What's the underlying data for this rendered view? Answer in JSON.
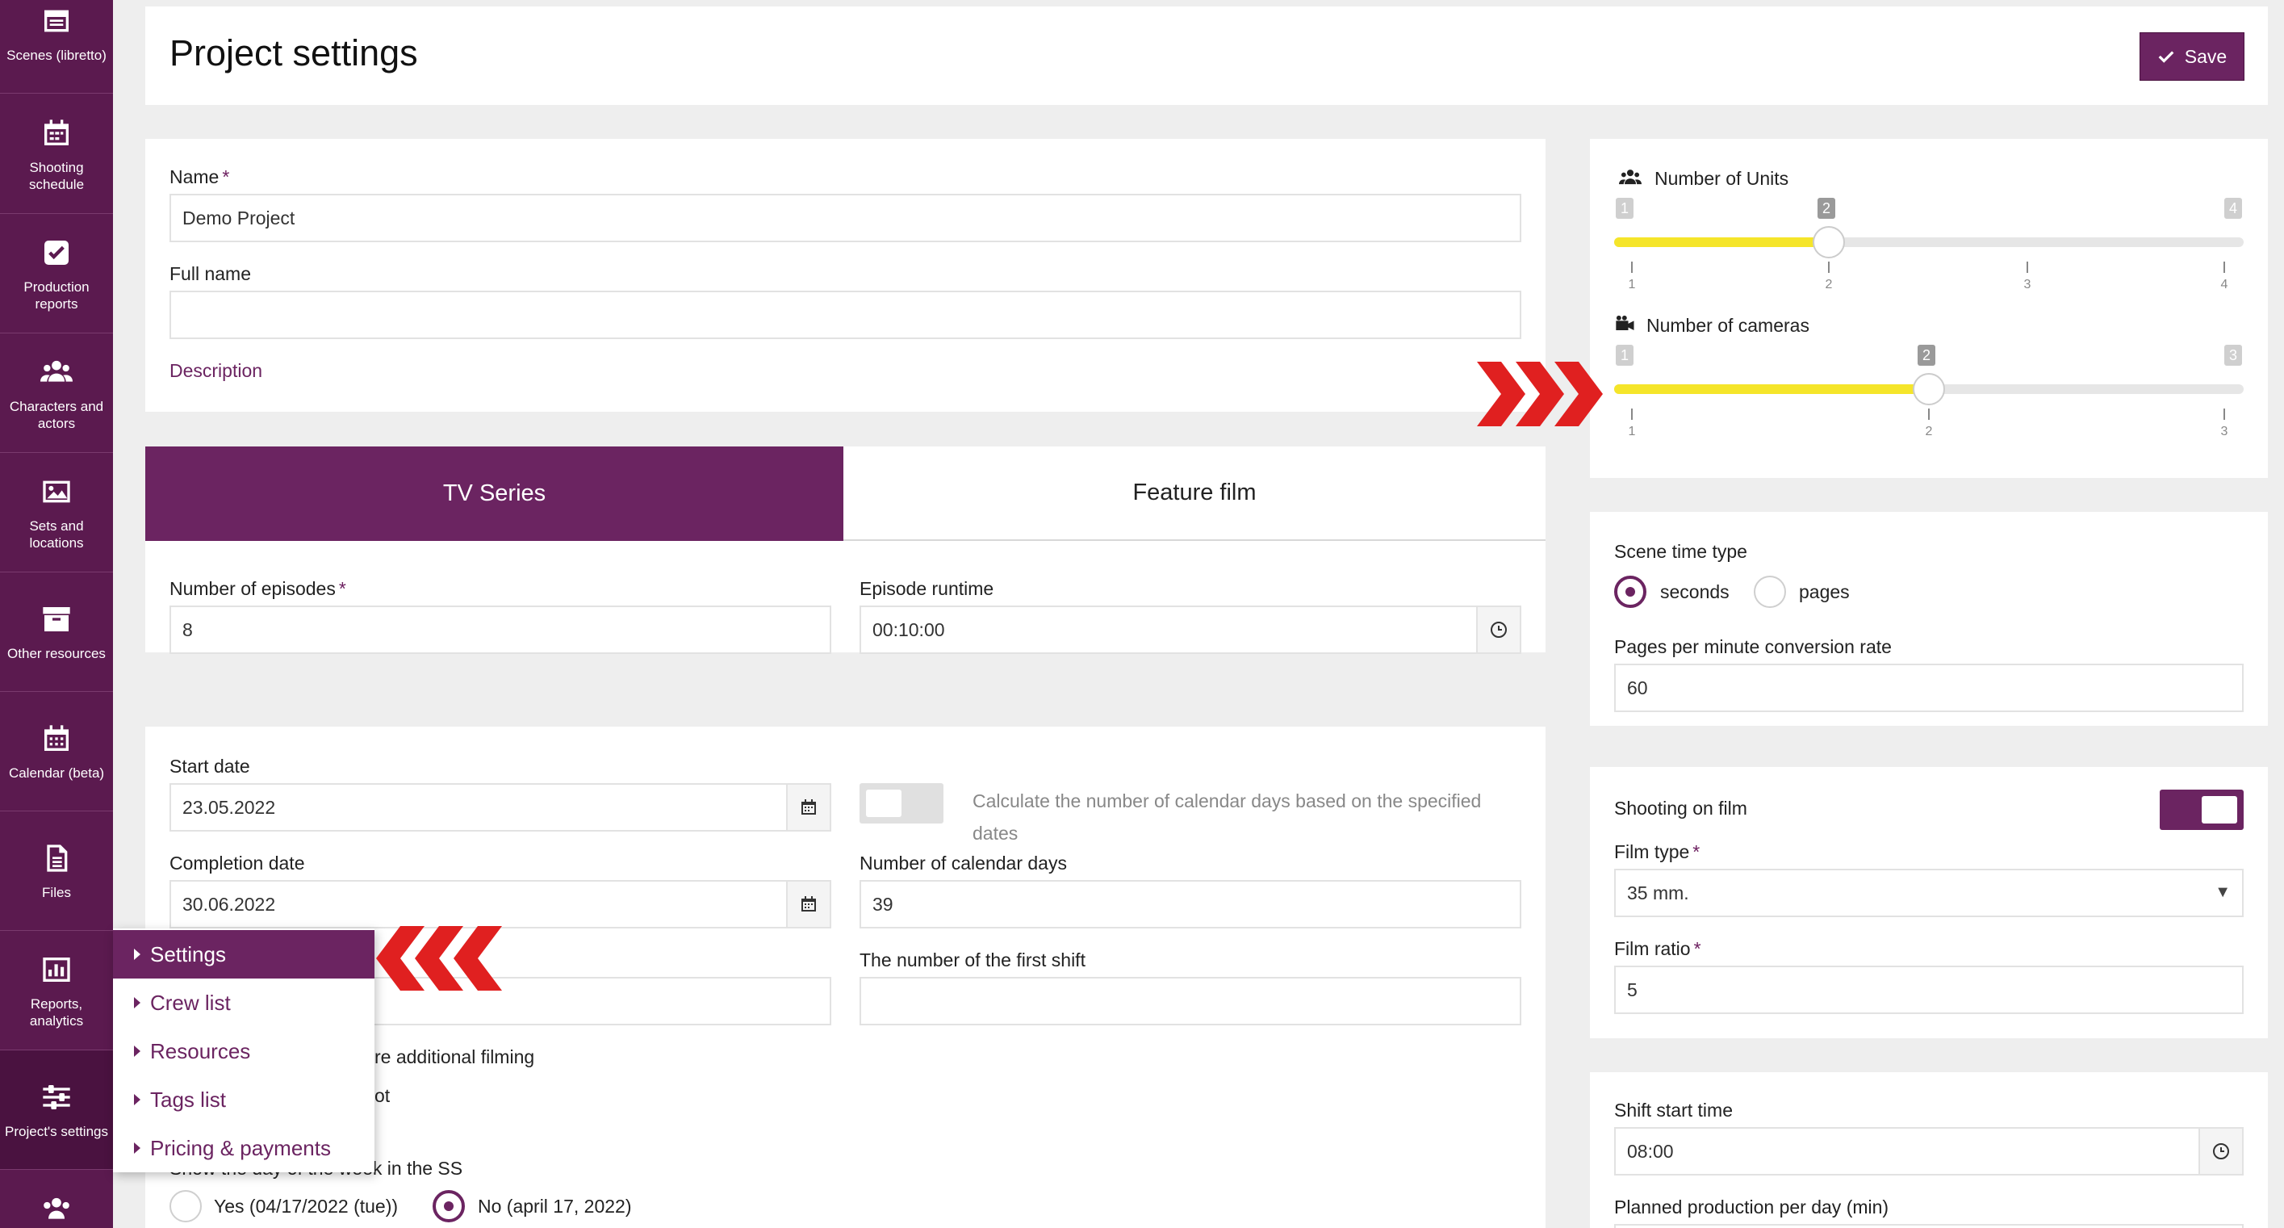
{
  "sidebar": {
    "items": [
      {
        "label": "Scenes (libretto)",
        "icon": "clapperboard-icon"
      },
      {
        "label": "Shooting schedule",
        "icon": "calendar-grid-icon"
      },
      {
        "label": "Production reports",
        "icon": "checkbox-icon"
      },
      {
        "label": "Characters and actors",
        "icon": "users-icon"
      },
      {
        "label": "Sets and locations",
        "icon": "image-icon"
      },
      {
        "label": "Other resources",
        "icon": "archive-icon"
      },
      {
        "label": "Calendar (beta)",
        "icon": "calendar-icon"
      },
      {
        "label": "Files",
        "icon": "file-icon"
      },
      {
        "label": "Reports, analytics",
        "icon": "bar-chart-icon"
      },
      {
        "label": "Project's settings",
        "icon": "sliders-icon"
      }
    ]
  },
  "header": {
    "title": "Project settings",
    "save_label": "Save"
  },
  "general": {
    "name_label": "Name",
    "name_value": "Demo Project",
    "fullname_label": "Full name",
    "fullname_value": "",
    "description_link": "Description"
  },
  "tabs": [
    {
      "label": "TV Series"
    },
    {
      "label": "Feature film"
    }
  ],
  "series": {
    "episodes_label": "Number of episodes",
    "episodes_value": "8",
    "runtime_label": "Episode runtime",
    "runtime_value": "00:10:00"
  },
  "dates": {
    "start_label": "Start date",
    "start_value": "23.05.2022",
    "completion_label": "Completion date",
    "completion_value": "30.06.2022",
    "calc_text": "Calculate the number of calendar days based on the specified dates",
    "calendar_days_label": "Number of calendar days",
    "calendar_days_value": "39",
    "first_shift_label": "The number of the first shift",
    "first_shift_value": "",
    "additional_filming_text": "re additional filming",
    "partial_text": "ot",
    "weekday_label": "Show the day of the week in the SS",
    "yes_label": "Yes (04/17/2022 (tue))",
    "no_label": "No (april 17, 2022)"
  },
  "units": {
    "units_label": "Number of Units",
    "units_min": "1",
    "units_max": "4",
    "units_value": "2",
    "units_ticks": [
      "1",
      "2",
      "3",
      "4"
    ],
    "cameras_label": "Number of cameras",
    "cameras_min": "1",
    "cameras_max": "3",
    "cameras_value": "2",
    "cameras_ticks": [
      "1",
      "2",
      "3"
    ]
  },
  "scene_time": {
    "label": "Scene time type",
    "opt_seconds": "seconds",
    "opt_pages": "pages",
    "selected": "seconds",
    "rate_label": "Pages per minute conversion rate",
    "rate_value": "60"
  },
  "film": {
    "shooting_label": "Shooting on film",
    "shooting_on": true,
    "type_label": "Film type",
    "type_value": "35 mm.",
    "ratio_label": "Film ratio",
    "ratio_value": "5"
  },
  "shift": {
    "start_label": "Shift start time",
    "start_value": "08:00",
    "planned_label": "Planned production per day (min)"
  },
  "settings_menu": {
    "items": [
      "Settings",
      "Crew list",
      "Resources",
      "Tags list",
      "Pricing & payments"
    ]
  },
  "colors": {
    "brand": "#6b2461",
    "sidebar": "#5b1a4f",
    "slider_fill": "#f5e52a",
    "arrow": "#e02020"
  }
}
